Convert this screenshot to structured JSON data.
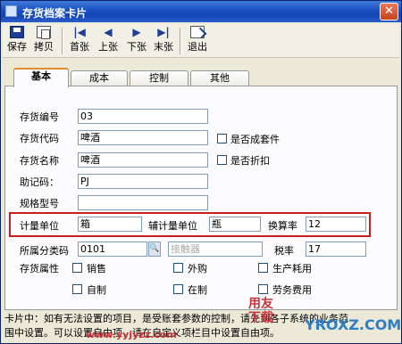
{
  "window": {
    "title": "存货档案卡片",
    "close_icon": "close-icon"
  },
  "toolbar": {
    "save": "保存",
    "copy": "拷贝",
    "first": "首张",
    "prev": "上张",
    "next": "下张",
    "last": "末张",
    "exit": "退出"
  },
  "tabs": [
    "基本",
    "成本",
    "控制",
    "其他"
  ],
  "form": {
    "code_label": "存货编号",
    "code_value": "03",
    "inv_code_label": "存货代码",
    "inv_code_value": "啤酒",
    "name_label": "存货名称",
    "name_value": "啤酒",
    "mnemonic_label": "助记码：",
    "mnemonic_value": "PJ",
    "spec_label": "规格型号",
    "spec_value": "",
    "is_set_label": "是否成套件",
    "is_discount_label": "是否折扣",
    "unit_label": "计量单位",
    "unit_value": "箱",
    "aux_unit_label": "辅计量单位",
    "aux_unit_value": "瓶",
    "rate_label": "换算率",
    "rate_value": "12",
    "category_label": "所属分类码",
    "category_value": "0101",
    "category_placeholder": "接触器",
    "tax_label": "税率",
    "tax_value": "17",
    "attr_label": "存货属性",
    "attr_sale": "销售",
    "attr_purchase": "外购",
    "attr_production": "生产耗用",
    "attr_self": "自制",
    "attr_wip": "在制",
    "attr_labor": "劳务费用"
  },
  "status": {
    "line1": "卡片中：如有无法设置的项目，是受账套参数的控制，请先到各子系统的业务范",
    "line2": "围中设置。可以设置自由项，请在自定义项栏目中设置自由项。"
  },
  "watermark": {
    "site": "www.yyjyzz.com",
    "brand": "用友下载",
    "logo": "YROXZ.COM"
  }
}
